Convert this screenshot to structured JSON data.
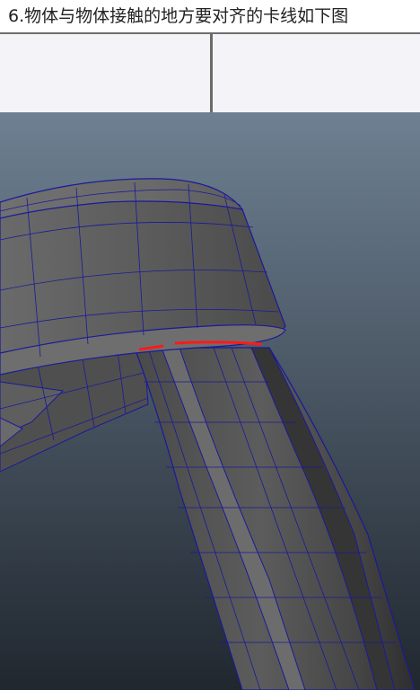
{
  "caption": {
    "text": "6.物体与物体接触的地方要对齐的卡线如下图"
  },
  "viewport": {
    "background_top": "#6e8092",
    "background_bottom": "#222a33",
    "mesh_fill": "#5a5a5a",
    "mesh_fill_light": "#6c6c6c",
    "mesh_fill_dark": "#3a3a3a",
    "wire_color": "#1a1a9a",
    "highlight_edge_color": "#ff1a1a"
  }
}
